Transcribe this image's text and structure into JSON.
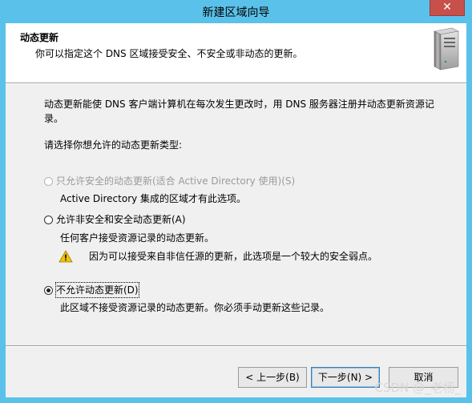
{
  "window": {
    "title": "新建区域向导",
    "close_glyph": "✕"
  },
  "header": {
    "title": "动态更新",
    "subtitle": "你可以指定这个 DNS 区域接受安全、不安全或非动态的更新。",
    "icon": "server-icon"
  },
  "main": {
    "description_line1": "动态更新能使 DNS 客户端计算机在每次发生更改时，用 DNS 服务器注册并动态更新资源记",
    "description_line2": "录。",
    "prompt": "请选择你想允许的动态更新类型:",
    "options": [
      {
        "label": "只允许安全的动态更新(适合 Active Directory 使用)(S)",
        "description": "Active Directory 集成的区域才有此选项。",
        "enabled": false,
        "selected": false
      },
      {
        "label": "允许非安全和安全动态更新(A)",
        "description": "任何客户接受资源记录的动态更新。",
        "warning": "因为可以接受来自非信任源的更新，此选项是一个较大的安全弱点。",
        "enabled": true,
        "selected": false
      },
      {
        "label": "不允许动态更新(D)",
        "description": "此区域不接受资源记录的动态更新。你必须手动更新这些记录。",
        "enabled": true,
        "selected": true
      }
    ]
  },
  "footer": {
    "back_label": "< 上一步(B)",
    "next_label": "下一步(N) >",
    "cancel_label": "取消"
  },
  "watermark": "CSDN @_老杨_",
  "colors": {
    "titlebar": "#5ac2ea",
    "close_button": "#c7504b",
    "dialog_bg": "#f0f0f0",
    "header_bg": "#ffffff",
    "warning": "#f5c400"
  }
}
